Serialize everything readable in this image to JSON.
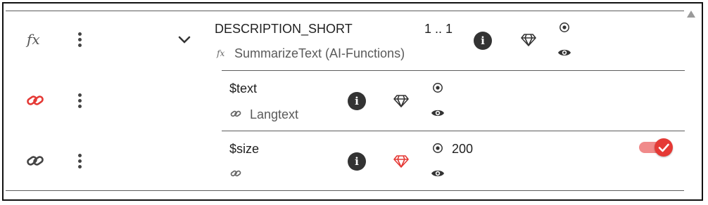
{
  "colors": {
    "accent_red": "#e53935",
    "toggle_track": "#f08a8a",
    "icon_dark": "#333333",
    "divider": "#5c5c5c"
  },
  "rows": {
    "function": {
      "fx_icon": "fx",
      "name": "DESCRIPTION_SHORT",
      "multiplicity": "1 .. 1",
      "function_label": "SummarizeText (AI-Functions)",
      "icons": [
        "fx-icon",
        "more-vert-icon",
        "chevron-down-icon",
        "info-icon",
        "diamond-icon",
        "radio-icon",
        "eye-icon"
      ]
    },
    "text_param": {
      "name": "$text",
      "link_label": "Langtext",
      "icons": [
        "link-icon-red",
        "more-vert-icon",
        "link-small-icon",
        "info-icon",
        "diamond-icon",
        "radio-icon",
        "eye-icon"
      ]
    },
    "size_param": {
      "name": "$size",
      "value": "200",
      "toggle_on": true,
      "icons": [
        "link-icon",
        "more-vert-icon",
        "link-small-icon",
        "info-icon",
        "diamond-icon-red",
        "radio-icon",
        "eye-icon",
        "toggle-switch"
      ]
    }
  }
}
